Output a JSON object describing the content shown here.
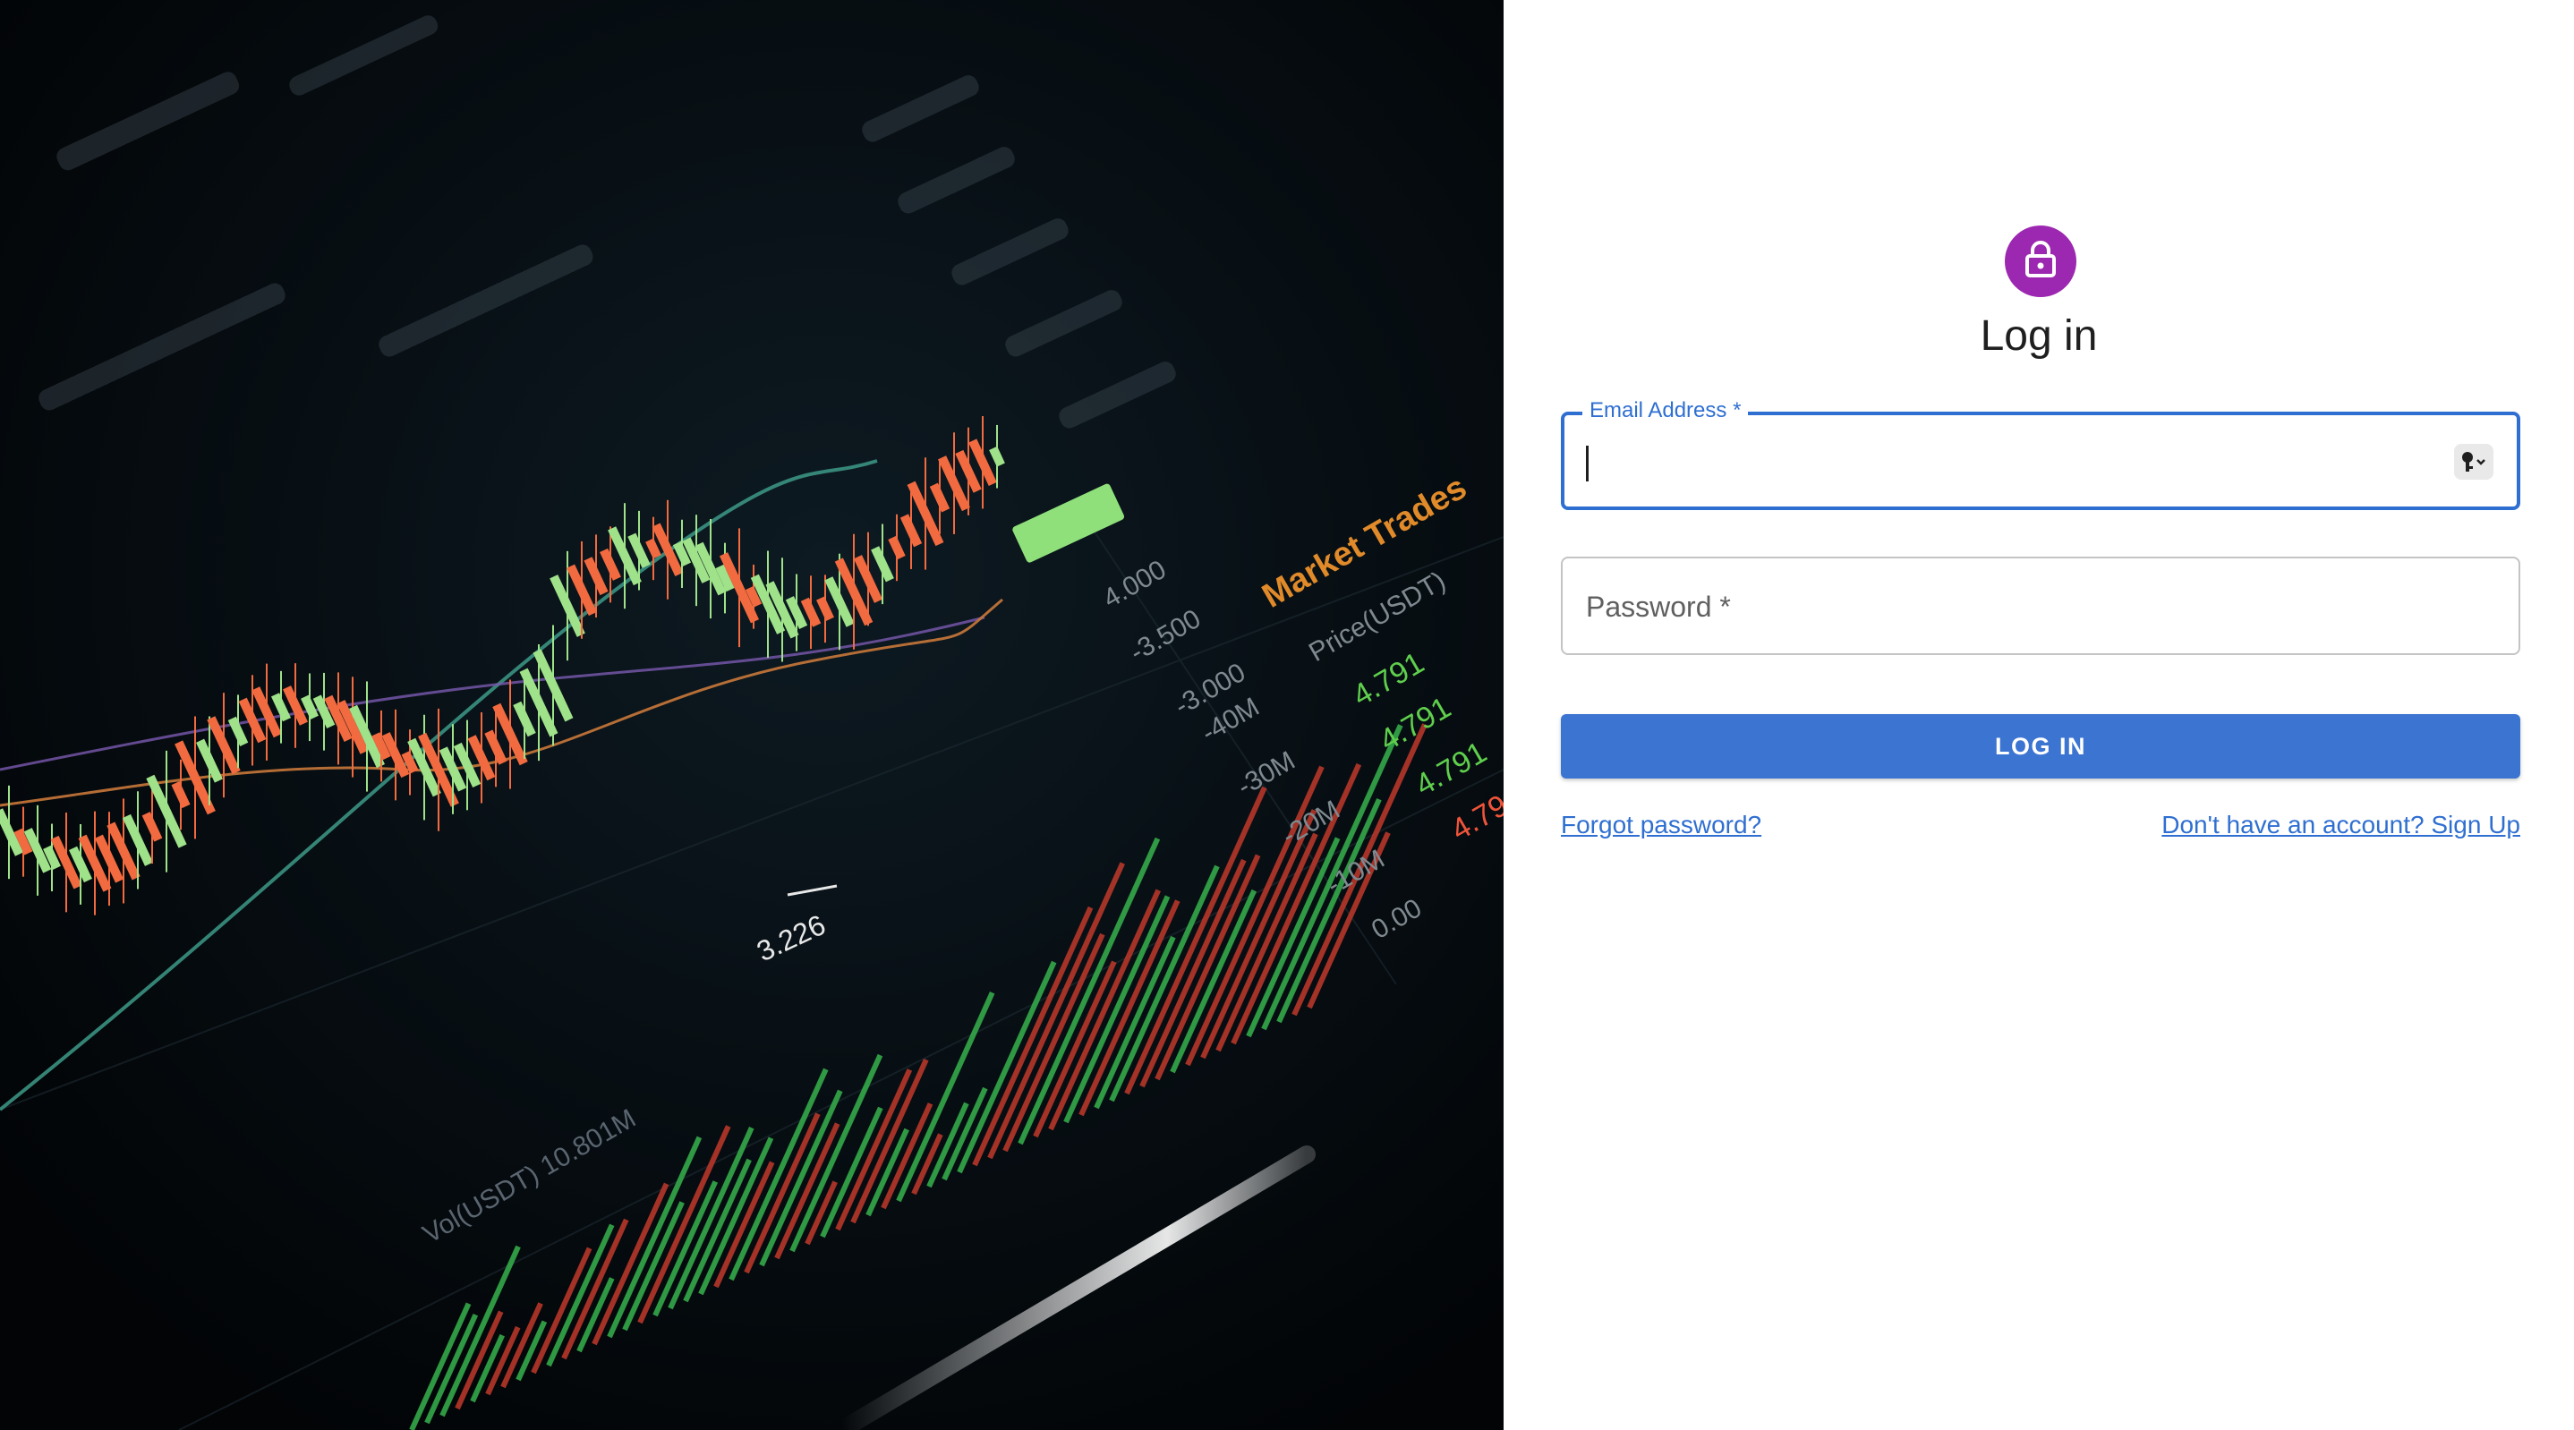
{
  "hero": {
    "chart_text": {
      "price_label": "3.226",
      "volume_ticks": [
        "-40M",
        "-30M",
        "-20M",
        "-10M",
        "0.00"
      ],
      "price_ticks": [
        "4.000",
        "-3.500",
        "-3.000"
      ],
      "market_trades": "Market Trades",
      "price_col": "Price(USDT)",
      "trade_prices": [
        "4.791",
        "4.791",
        "4.791",
        "4.79"
      ],
      "vol_label": "Vol(USDT) 10.801M"
    },
    "colors": {
      "up": "#9fe28a",
      "down": "#f26a3f",
      "volume_up": "#37b24d",
      "volume_down": "#c0392b"
    }
  },
  "auth": {
    "icon": "lock-icon",
    "avatar_color": "#9c27b0",
    "title": "Log in",
    "email": {
      "label": "Email Address *",
      "value": "",
      "autofill_icon": "key-icon"
    },
    "password": {
      "placeholder": "Password *",
      "value": ""
    },
    "submit_label": "LOG IN",
    "forgot_link": "Forgot password?",
    "signup_link": "Don't have an account? Sign Up",
    "accent_color": "#3b74d1"
  }
}
